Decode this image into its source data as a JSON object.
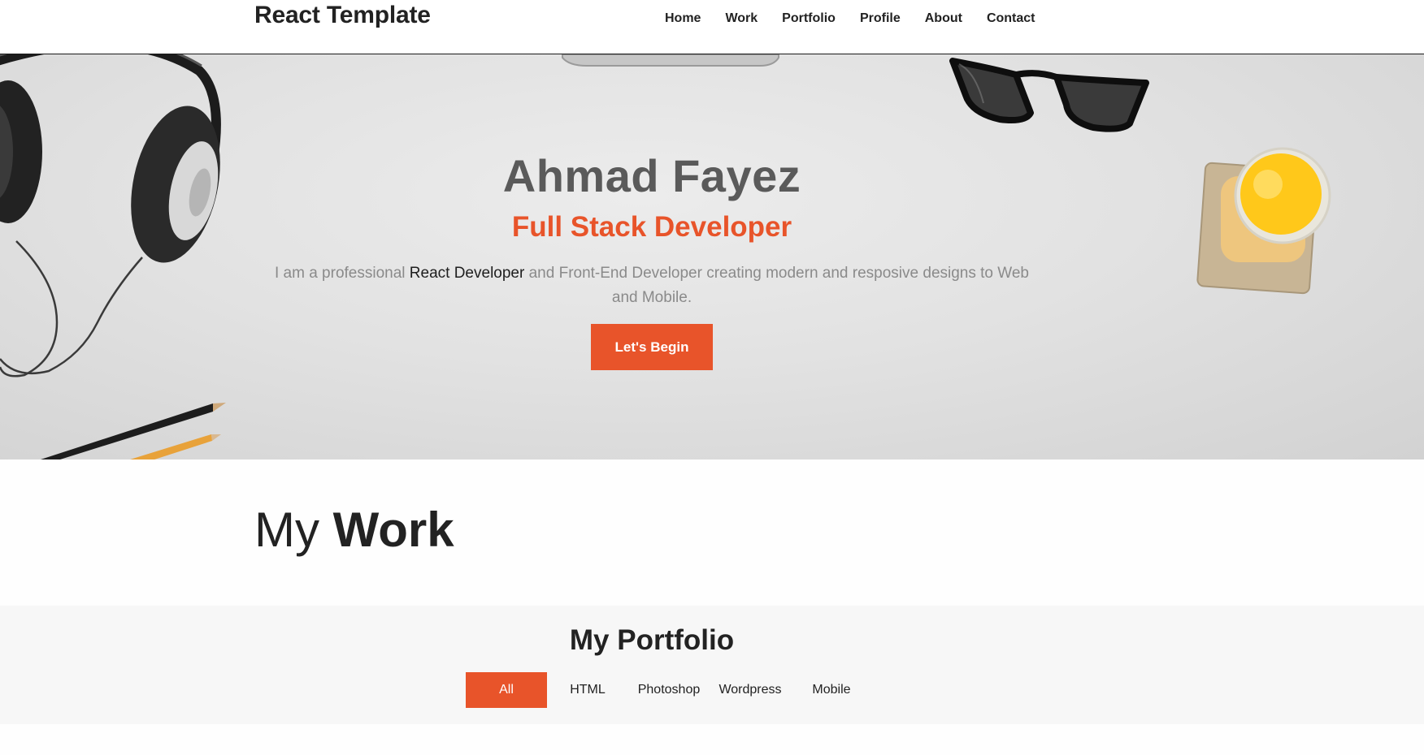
{
  "navbar": {
    "brand": "React Template",
    "links": [
      "Home",
      "Work",
      "Portfolio",
      "Profile",
      "About",
      "Contact"
    ]
  },
  "hero": {
    "name": "Ahmad Fayez",
    "role": "Full Stack Developer",
    "description_prefix": "I am a professional ",
    "description_highlight": "React Developer",
    "description_suffix": " and Front-End Developer creating modern and resposive designs to Web and Mobile.",
    "cta_label": "Let's Begin",
    "decor_icons": [
      "headphones-icon",
      "pencils-icon",
      "glasses-icon",
      "juice-glass-icon",
      "laptop-edge-icon"
    ]
  },
  "work": {
    "title_light": "My ",
    "title_bold": "Work"
  },
  "portfolio": {
    "title_light": "My ",
    "title_bold": "Portfolio",
    "filters": [
      "All",
      "HTML",
      "Photoshop",
      "Wordpress",
      "Mobile"
    ],
    "active_filter": "All"
  },
  "colors": {
    "accent": "#e8542a",
    "heading_gray": "#5a5a5a",
    "text_dark": "#222222",
    "section_bg": "#f7f7f7"
  }
}
